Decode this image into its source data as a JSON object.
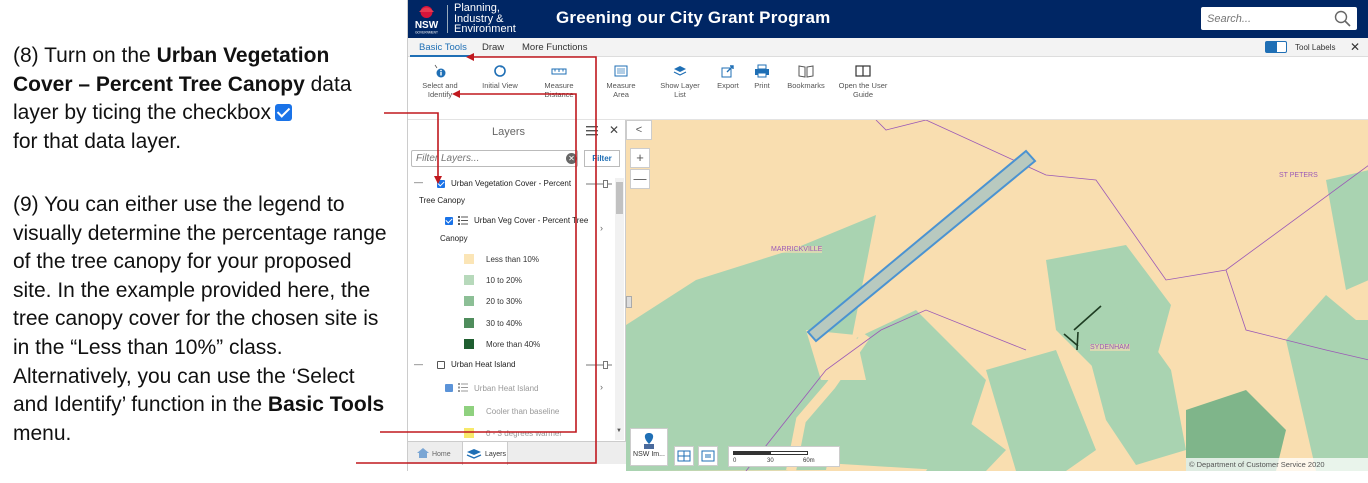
{
  "instructions": {
    "step8": {
      "prefix": "(8) Turn on the ",
      "bold": "Urban Vegetation Cover – Percent Tree Canopy",
      "suffix1": " data layer by ticing the checkbox",
      "suffix2": "for that data layer."
    },
    "step9": {
      "text": "(9) You can either use the legend to visually determine the percentage range of the tree canopy for your proposed site. In the example provided here, the tree canopy cover for the chosen site is in the “Less than 10%” class. Alternatively, you can use the ‘Select and Identify’ function in the ",
      "bold": "Basic Tools",
      "suffix": " menu."
    }
  },
  "header": {
    "brand": "NSW",
    "brand_sub": "GOVERNMENT",
    "agency_line1": "Planning,",
    "agency_line2": "Industry &",
    "agency_line3": "Environment",
    "title": "Greening our City Grant Program",
    "search_placeholder": "Search..."
  },
  "tabs": {
    "basic": "Basic Tools",
    "draw": "Draw",
    "more": "More Functions",
    "tool_labels": "Tool Labels",
    "close": "✕"
  },
  "toolbar": {
    "select_identify_1": "Select and",
    "select_identify_2": "Identify",
    "initial_view": "Initial View",
    "measure_distance_1": "Measure",
    "measure_distance_2": "Distance",
    "measure_area": "Measure Area",
    "show_layer_list": "Show Layer List",
    "export": "Export",
    "print": "Print",
    "bookmarks": "Bookmarks",
    "user_guide_1": "Open the User",
    "user_guide_2": "Guide"
  },
  "layers": {
    "title": "Layers",
    "close": "✕",
    "filter_placeholder": "Filter Layers...",
    "filter_button": "Filter",
    "layer1": {
      "name_1": "Urban Vegetation Cover - Percent",
      "name_2": "Tree Canopy",
      "sublayer_1": "Urban Veg Cover - Percent Tree",
      "sublayer_2": "Canopy",
      "legend": [
        {
          "label": "Less than 10%",
          "color": "#fbe5b6"
        },
        {
          "label": "10 to 20%",
          "color": "#b7d9bb"
        },
        {
          "label": "20 to 30%",
          "color": "#8cbf96"
        },
        {
          "label": "30 to 40%",
          "color": "#4f8d5c"
        },
        {
          "label": "More than 40%",
          "color": "#1f5e30"
        }
      ]
    },
    "layer2": {
      "name": "Urban Heat Island",
      "sublayer": "Urban Heat Island",
      "legend": [
        {
          "label": "Cooler than baseline",
          "color": "#8fd17f"
        },
        {
          "label": "0 - 3 degrees warmer",
          "color": "#f7e96a"
        }
      ]
    },
    "bottom_home": "Home",
    "bottom_layers": "Layers"
  },
  "map": {
    "labels": {
      "st_peters": "ST PETERS",
      "marrickville": "MARRICKVILLE",
      "sydenham": "SYDENHAM"
    },
    "basemap": "NSW Im...",
    "scale_0": "0",
    "scale_30": "30",
    "scale_60": "60m",
    "copyright": "© Department of Customer Service 2020",
    "zoom_in": "+",
    "zoom_out": "—",
    "collapse": "<"
  },
  "colors": {
    "header_bg": "#002664",
    "accent": "#1f6fb5",
    "annotation": "#c0181e",
    "map_land": "#f9deb0",
    "map_green": "#a9d3b1"
  }
}
